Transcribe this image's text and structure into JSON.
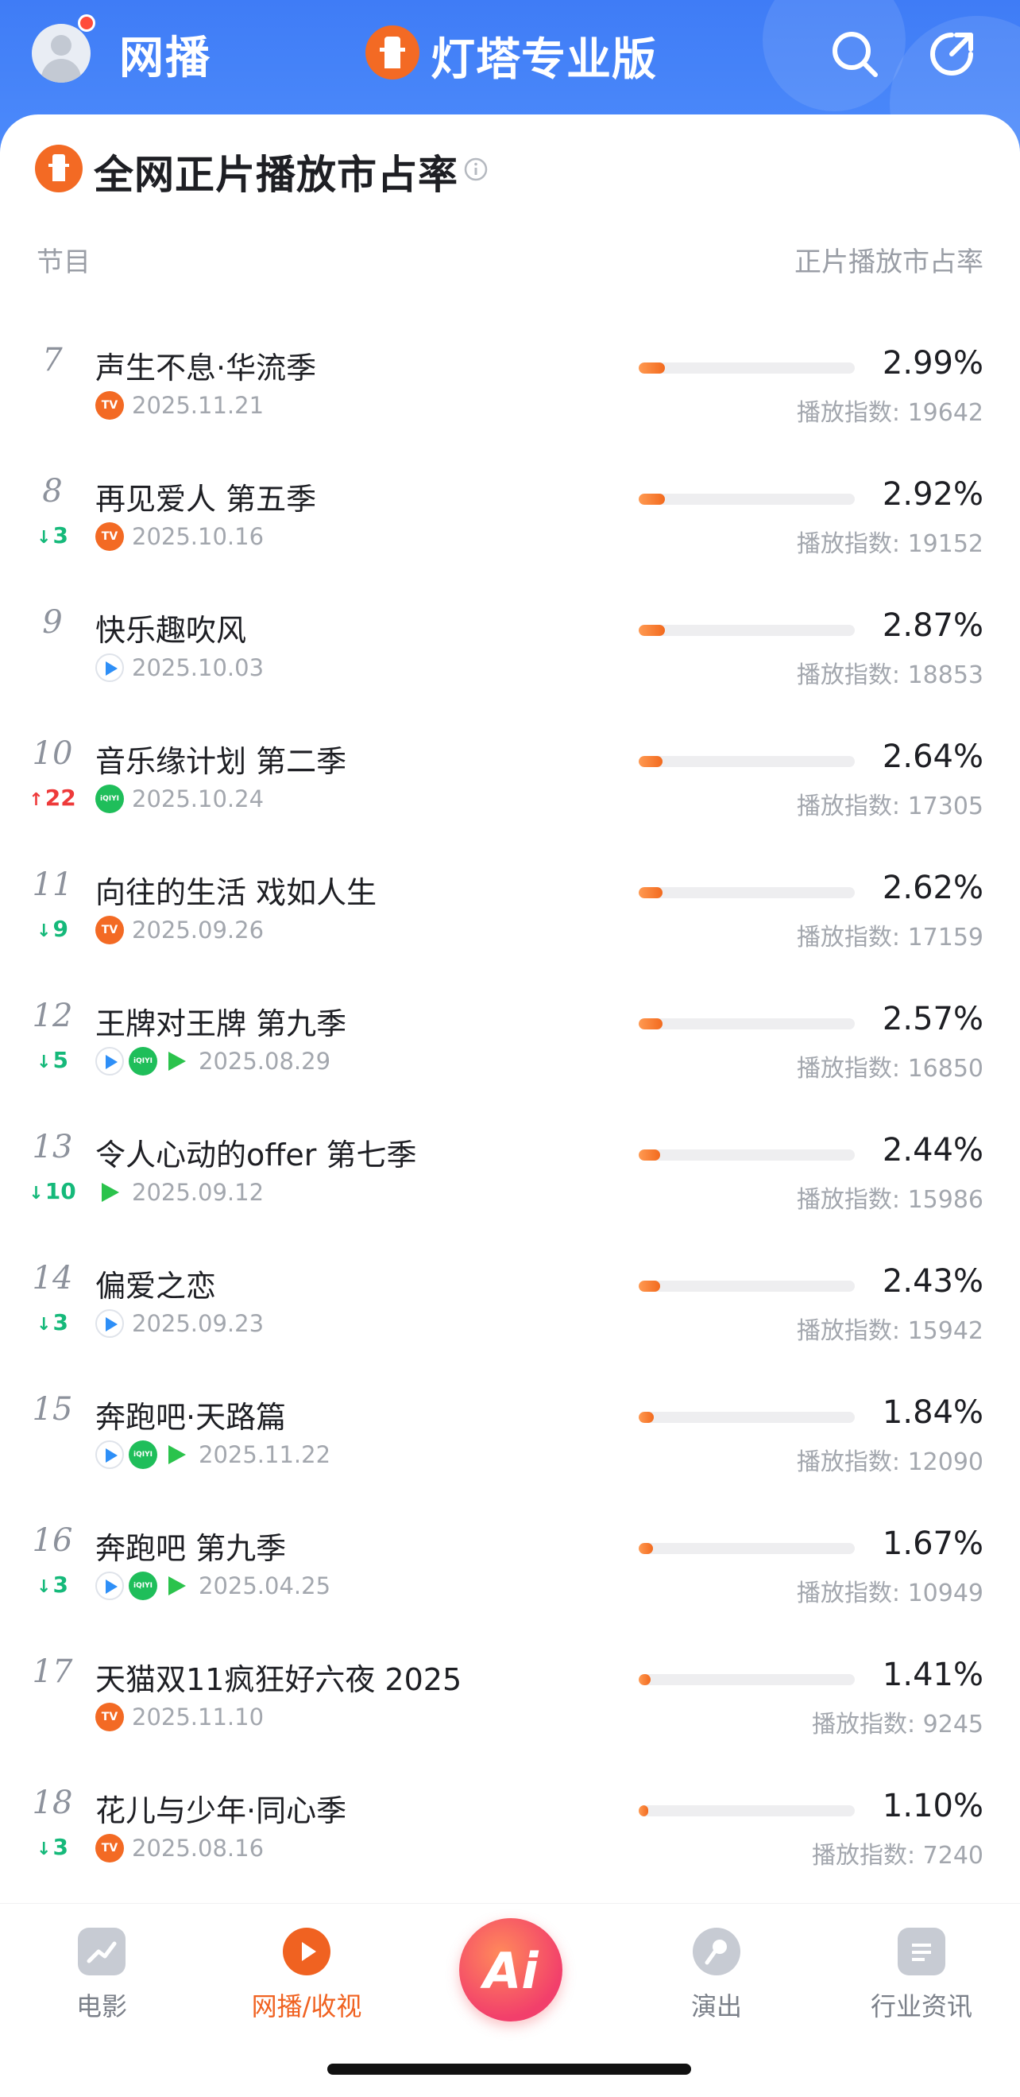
{
  "header": {
    "title": "网播",
    "brand": "灯塔专业版"
  },
  "section": {
    "title": "全网正片播放市占率",
    "col_left": "节目",
    "col_right": "正片播放市占率"
  },
  "rows": [
    {
      "rank": "7",
      "change": "",
      "dir": "",
      "name": "声生不息·华流季",
      "platforms": [
        "mango"
      ],
      "date": "2025.11.21",
      "share": "2.99%",
      "index": "播放指数: 19642",
      "bar": 0.12
    },
    {
      "rank": "8",
      "change": "3",
      "dir": "down",
      "name": "再见爱人 第五季",
      "platforms": [
        "mango"
      ],
      "date": "2025.10.16",
      "share": "2.92%",
      "index": "播放指数: 19152",
      "bar": 0.12
    },
    {
      "rank": "9",
      "change": "",
      "dir": "",
      "name": "快乐趣吹风",
      "platforms": [
        "youku"
      ],
      "date": "2025.10.03",
      "share": "2.87%",
      "index": "播放指数: 18853",
      "bar": 0.12
    },
    {
      "rank": "10",
      "change": "22",
      "dir": "up",
      "name": "音乐缘计划 第二季",
      "platforms": [
        "iqiyi"
      ],
      "date": "2025.10.24",
      "share": "2.64%",
      "index": "播放指数: 17305",
      "bar": 0.11
    },
    {
      "rank": "11",
      "change": "9",
      "dir": "down",
      "name": "向往的生活 戏如人生",
      "platforms": [
        "mango"
      ],
      "date": "2025.09.26",
      "share": "2.62%",
      "index": "播放指数: 17159",
      "bar": 0.11
    },
    {
      "rank": "12",
      "change": "5",
      "dir": "down",
      "name": "王牌对王牌 第九季",
      "platforms": [
        "youku",
        "iqiyi",
        "tencent"
      ],
      "date": "2025.08.29",
      "share": "2.57%",
      "index": "播放指数: 16850",
      "bar": 0.11
    },
    {
      "rank": "13",
      "change": "10",
      "dir": "down",
      "name": "令人心动的offer 第七季",
      "platforms": [
        "tencent"
      ],
      "date": "2025.09.12",
      "share": "2.44%",
      "index": "播放指数: 15986",
      "bar": 0.1
    },
    {
      "rank": "14",
      "change": "3",
      "dir": "down",
      "name": "偏爱之恋",
      "platforms": [
        "youku"
      ],
      "date": "2025.09.23",
      "share": "2.43%",
      "index": "播放指数: 15942",
      "bar": 0.1
    },
    {
      "rank": "15",
      "change": "",
      "dir": "",
      "name": "奔跑吧·天路篇",
      "platforms": [
        "youku",
        "iqiyi",
        "tencent"
      ],
      "date": "2025.11.22",
      "share": "1.84%",
      "index": "播放指数: 12090",
      "bar": 0.07
    },
    {
      "rank": "16",
      "change": "3",
      "dir": "down",
      "name": "奔跑吧 第九季",
      "platforms": [
        "youku",
        "iqiyi",
        "tencent"
      ],
      "date": "2025.04.25",
      "share": "1.67%",
      "index": "播放指数: 10949",
      "bar": 0.065
    },
    {
      "rank": "17",
      "change": "",
      "dir": "",
      "name": "天猫双11疯狂好六夜 2025",
      "platforms": [
        "mango"
      ],
      "date": "2025.11.10",
      "share": "1.41%",
      "index": "播放指数: 9245",
      "bar": 0.055
    },
    {
      "rank": "18",
      "change": "3",
      "dir": "down",
      "name": "花儿与少年·同心季",
      "platforms": [
        "mango"
      ],
      "date": "2025.08.16",
      "share": "1.10%",
      "index": "播放指数: 7240",
      "bar": 0.045
    }
  ],
  "nav": {
    "items": [
      {
        "label": "电影",
        "icon": "movie-trend-icon",
        "active": false
      },
      {
        "label": "网播/收视",
        "icon": "play-icon",
        "active": true
      },
      {
        "label": "演出",
        "icon": "microphone-icon",
        "active": false
      },
      {
        "label": "行业资讯",
        "icon": "news-icon",
        "active": false
      }
    ],
    "ai_label": "Ai"
  },
  "colors": {
    "header_blue": "#4585f8",
    "accent_orange": "#f06221",
    "down_green": "#15b97a",
    "up_red": "#ee3a3a"
  }
}
